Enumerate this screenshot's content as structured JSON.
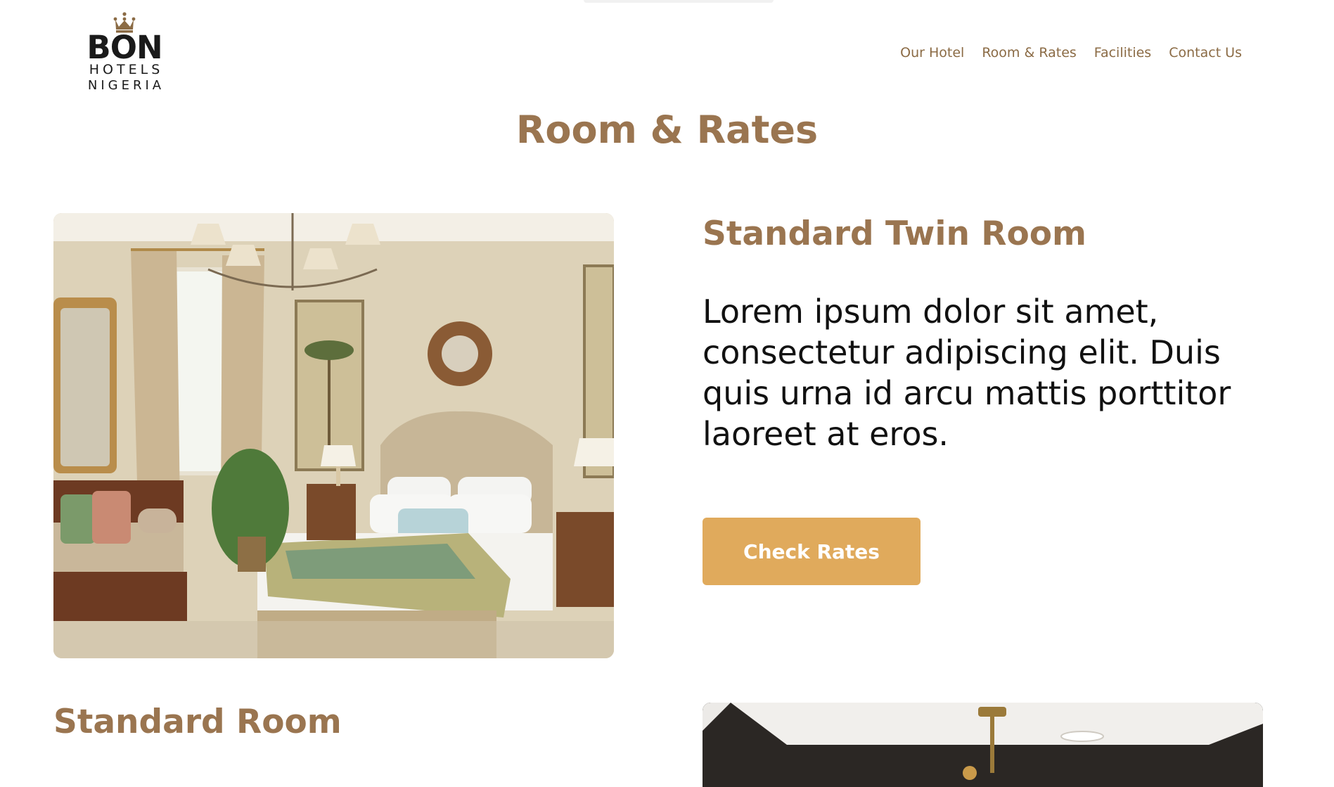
{
  "brand": {
    "name": "BON",
    "line2": "HOTELS",
    "line3": "NIGERIA",
    "crown_icon": "crown-icon"
  },
  "nav": {
    "items": [
      "Our Hotel",
      "Room & Rates",
      "Facilities",
      "Contact Us"
    ]
  },
  "page": {
    "title": "Room & Rates"
  },
  "rooms": [
    {
      "name": "Standard Twin Room",
      "description": "Lorem ipsum dolor sit amet, consectetur adipiscing elit. Duis quis urna id arcu mattis porttitor laoreet at eros.",
      "cta_label": "Check Rates"
    },
    {
      "name": "Standard Room"
    }
  ],
  "colors": {
    "accent_brown": "#9a7550",
    "nav_brown": "#8b6b45",
    "button_gold": "#e0aa5c"
  }
}
